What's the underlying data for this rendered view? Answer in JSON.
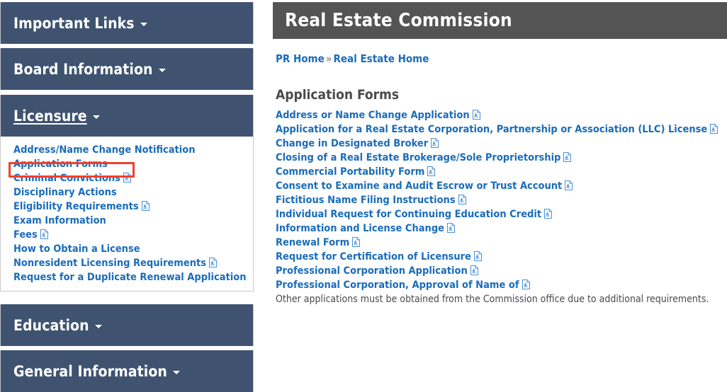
{
  "colors": {
    "sidebar_header_bg": "#3f5371",
    "banner_bg": "#545454",
    "link_blue": "#1a6cba",
    "highlight_red": "#f1402c",
    "body_text": "#4a4a4a",
    "panel_border": "#c9c9c9"
  },
  "sidebar": {
    "sections": [
      {
        "label": "Important Links",
        "caret": "chevron-down-icon",
        "active": false,
        "expanded": false
      },
      {
        "label": "Board Information",
        "caret": "chevron-down-icon",
        "active": false,
        "expanded": false
      },
      {
        "label": "Licensure",
        "caret": "chevron-down-icon",
        "active": true,
        "expanded": true
      },
      {
        "label": "Education",
        "caret": "chevron-down-icon",
        "active": false,
        "expanded": false
      },
      {
        "label": "General Information",
        "caret": "chevron-down-icon",
        "active": false,
        "expanded": false
      }
    ],
    "licensure_items": [
      {
        "label": "Address/Name Change Notification",
        "pdf": false,
        "highlighted": false
      },
      {
        "label": "Application Forms",
        "pdf": false,
        "highlighted": true
      },
      {
        "label": "Criminal Convictions",
        "pdf": true,
        "highlighted": false
      },
      {
        "label": "Disciplinary Actions",
        "pdf": false,
        "highlighted": false
      },
      {
        "label": "Eligibility Requirements",
        "pdf": true,
        "highlighted": false
      },
      {
        "label": "Exam Information",
        "pdf": false,
        "highlighted": false
      },
      {
        "label": "Fees",
        "pdf": true,
        "highlighted": false
      },
      {
        "label": "How to Obtain a License",
        "pdf": false,
        "highlighted": false
      },
      {
        "label": "Nonresident Licensing Requirements",
        "pdf": true,
        "highlighted": false
      },
      {
        "label": "Request for a Duplicate Renewal Application",
        "pdf": false,
        "highlighted": false
      }
    ]
  },
  "main": {
    "banner_title": "Real Estate Commission",
    "breadcrumb": {
      "home_label": "PR Home",
      "separator": "»",
      "current_label": "Real Estate Home"
    },
    "section_heading": "Application Forms",
    "form_links": [
      {
        "label": "Address or Name Change Application",
        "pdf": true
      },
      {
        "label": "Application for a Real Estate Corporation, Partnership or Association (LLC) License",
        "pdf": true
      },
      {
        "label": "Change in Designated Broker",
        "pdf": true
      },
      {
        "label": "Closing of a Real Estate Brokerage/Sole Proprietorship",
        "pdf": true
      },
      {
        "label": "Commercial Portability Form",
        "pdf": true
      },
      {
        "label": "Consent to Examine and Audit Escrow or Trust Account",
        "pdf": true
      },
      {
        "label": "Fictitious Name Filing Instructions",
        "pdf": true
      },
      {
        "label": "Individual Request for Continuing Education Credit",
        "pdf": true
      },
      {
        "label": "Information and License Change",
        "pdf": true
      },
      {
        "label": "Renewal Form",
        "pdf": true
      },
      {
        "label": "Request for Certification of Licensure",
        "pdf": true
      },
      {
        "label": "Professional Corporation Application",
        "pdf": true
      },
      {
        "label": "Professional Corporation, Approval of Name of",
        "pdf": true
      }
    ],
    "footer_note": "Other applications must be obtained from the Commission office due to additional requirements."
  }
}
